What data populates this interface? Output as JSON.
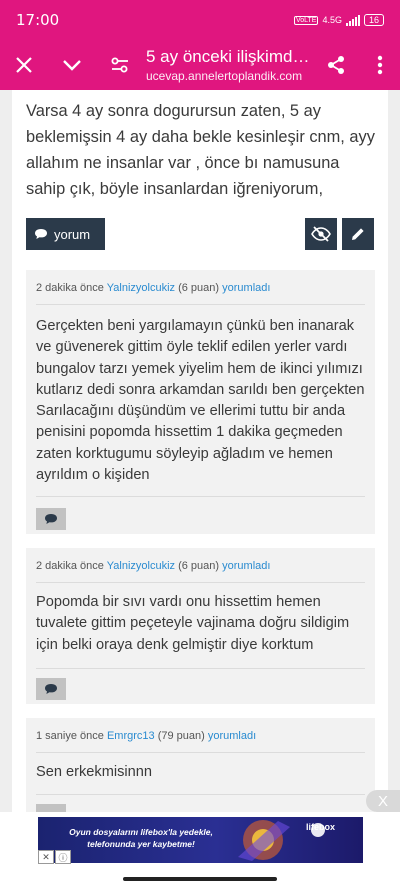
{
  "status_bar": {
    "time": "17:00",
    "network": "4.5G",
    "sim": "VoLTE",
    "battery": "16"
  },
  "app_bar": {
    "title": "5 ay önceki ilişkimde...",
    "url": "ucevap.annelertoplandik.com",
    "icons": [
      "close-icon",
      "chevron-down-icon",
      "tune-icon",
      "share-icon",
      "more-vert-icon"
    ]
  },
  "post": {
    "text": "Varsa 4 ay sonra dogurursun zaten, 5 ay beklemişsin 4 ay daha bekle kesinleşir cnm, ayy allahım ne insanlar var , önce bı namusuna sahip çık, böyle insanlardan iğreniyorum,",
    "comment_button_label": "yorum",
    "hide_icon": "eye-off-icon",
    "edit_icon": "pencil-icon"
  },
  "comments": [
    {
      "time": "2 dakika önce",
      "user": "Yalnizyolcukiz",
      "points": "(6 puan)",
      "action": "yorumladı",
      "text": "Gerçekten beni yargılamayın çünkü ben inanarak ve güvenerek gittim öyle teklif edilen yerler vardı bungalov tarzı yemek yiyelim hem de ikinci yılımızı kutlarız dedi sonra arkamdan sarıldı ben gerçekten Sarılacağını düşündüm ve ellerimi tuttu bir anda penisini popomda hissettim 1 dakika geçmeden zaten korktugumu söyleyip ağladım ve hemen ayrıldım o kişiden"
    },
    {
      "time": "2 dakika önce",
      "user": "Yalnizyolcukiz",
      "points": "(6 puan)",
      "action": "yorumladı",
      "text": "Popomda bir sıvı vardı onu hissettim hemen tuvalete gittim peçeteyle vajinama doğru sildigim için belki oraya denk gelmiştir diye korktum"
    },
    {
      "time": "1 saniye önce",
      "user": "Emrgrc13",
      "points": "(79 puan)",
      "action": "yorumladı",
      "text": "Sen erkekmisinnn"
    }
  ],
  "ad": {
    "text": "Oyun dosyalarını lifebox'la yedekle, telefonunda yer kaybetme!",
    "brand": "lifebox",
    "close": "X"
  }
}
